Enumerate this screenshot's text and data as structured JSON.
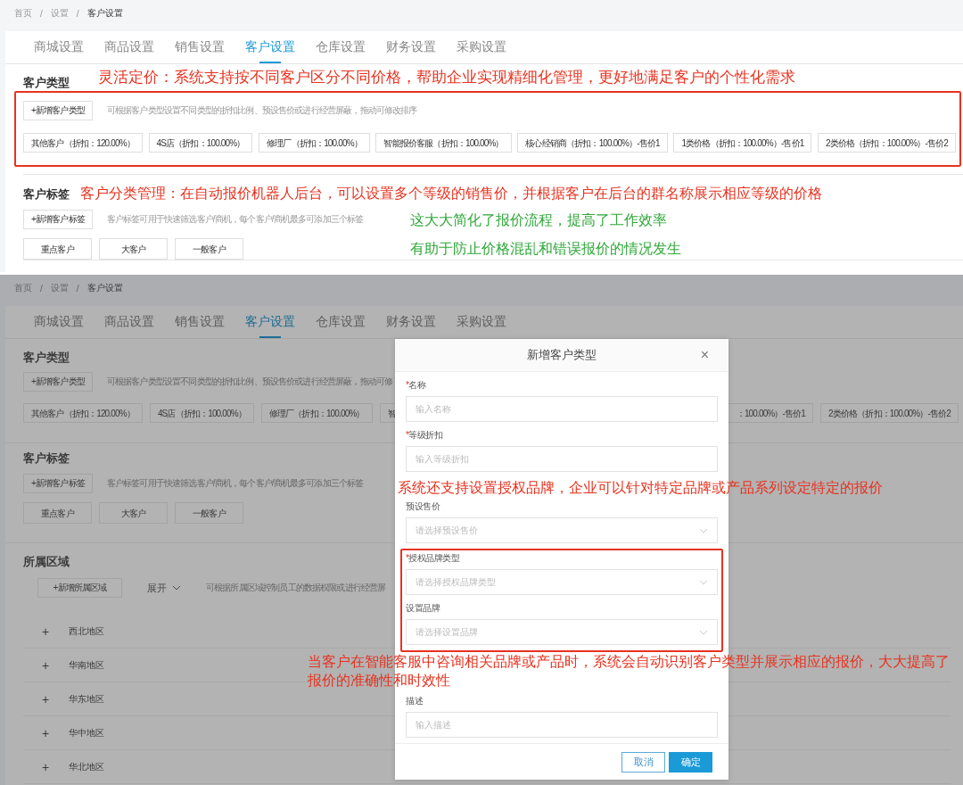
{
  "top_view": {
    "breadcrumb": [
      {
        "label": "首页",
        "separator": "/"
      },
      {
        "label": "设置",
        "separator": "/"
      },
      {
        "label": "客户设置"
      }
    ],
    "tabs": [
      {
        "label": "商城设置",
        "selected": false
      },
      {
        "label": "商品设置",
        "selected": false
      },
      {
        "label": "销售设置",
        "selected": false
      },
      {
        "label": "客户设置",
        "selected": true
      },
      {
        "label": "仓库设置",
        "selected": false
      },
      {
        "label": "财务设置",
        "selected": false
      },
      {
        "label": "采购设置",
        "selected": false
      }
    ],
    "customer_types": {
      "title": "客户类型",
      "annotation": "灵活定价：系统支持按不同客户区分不同价格，帮助企业实现精细化管理，更好地满足客户的个性化需求",
      "highlighted": true,
      "add_button": "+新增客户类型",
      "description": "可根据客户类型设置不同类型的折扣比例、预设售价或进行经营屏蔽，拖动可修改排序",
      "items": [
        "其他客户（折扣：120.00%）",
        "4S店（折扣：100.00%）",
        "修理厂（折扣：100.00%）",
        "智能报价客服（折扣：100.00%）",
        "核心经销商（折扣：100.00%）-售价1",
        "1类价格（折扣：100.00%）-售价1",
        "2类价格（折扣：100.00%）-售价2"
      ]
    },
    "customer_tags": {
      "title": "客户标签",
      "annotation": "客户分类管理：在自动报价机器人后台，可以设置多个等级的销售价，并根据客户在后台的群名称展示相应等级的价格",
      "add_button": "+新增客户标签",
      "description": "客户标签可用于快速筛选客户/商机，每个客户/商机最多可添加三个标签",
      "items": [
        "重点客户",
        "大客户",
        "一般客户"
      ]
    },
    "notes": [
      "这大大简化了报价流程，提高了工作效率",
      "有助于防止价格混乱和错误报价的情况发生"
    ]
  },
  "bottom_view": {
    "breadcrumb": [
      {
        "label": "首页",
        "separator": "/"
      },
      {
        "label": "设置",
        "separator": "/"
      },
      {
        "label": "客户设置"
      }
    ],
    "tabs": [
      {
        "label": "商城设置",
        "selected": false
      },
      {
        "label": "商品设置",
        "selected": false
      },
      {
        "label": "销售设置",
        "selected": false
      },
      {
        "label": "客户设置",
        "selected": true
      },
      {
        "label": "仓库设置",
        "selected": false
      },
      {
        "label": "财务设置",
        "selected": false
      },
      {
        "label": "采购设置",
        "selected": false
      }
    ],
    "customer_types": {
      "title": "客户类型",
      "add_button": "+新增客户类型",
      "description": "可根据客户类型设置不同类型的折扣比例、预设售价或进行经营屏蔽，拖动可修",
      "items": [
        "其他客户（折扣：120.00%）",
        "4S店（折扣：100.00%）",
        "修理厂（折扣：100.00%）",
        "智",
        "：100.00%）-售价1",
        "2类价格（折扣：100.00%）-售价2"
      ]
    },
    "customer_tags": {
      "title": "客户标签",
      "add_button": "+新增客户标签",
      "description": "客户标签可用于快速筛选客户/商机，每个客户/商机最多可添加三个标签",
      "items": [
        "重点客户",
        "大客户",
        "一般客户"
      ]
    },
    "regions": {
      "title": "所属区域",
      "add_button": "+新增所属区域",
      "expand_toggle": "展开",
      "description": "可根据所属区域控制员工的数据权限或进行经营屏",
      "rows": [
        {
          "toggle": "+",
          "label": "西北地区"
        },
        {
          "toggle": "+",
          "label": "华南地区"
        },
        {
          "toggle": "+",
          "label": "华东地区"
        },
        {
          "toggle": "+",
          "label": "华中地区"
        },
        {
          "toggle": "+",
          "label": "华北地区"
        }
      ]
    },
    "dialog": {
      "title": "新增客户类型",
      "close": "×",
      "fields": [
        {
          "mark": "*",
          "label": "名称",
          "kind": "input",
          "placeholder": "输入名称",
          "highlighted": false
        },
        {
          "mark": "*",
          "label": "等级折扣",
          "kind": "input",
          "placeholder": "输入等级折扣",
          "highlighted": false
        },
        {
          "label": "预设售价",
          "kind": "select",
          "placeholder": "请选择预设售价",
          "highlighted": false
        },
        {
          "mark": "*",
          "label": "授权品牌类型",
          "kind": "select",
          "placeholder": "请选择授权品牌类型",
          "highlighted": true
        },
        {
          "label": "设置品牌",
          "kind": "select",
          "placeholder": "请选择设置品牌",
          "highlighted": true
        },
        {
          "label": "描述",
          "kind": "input",
          "placeholder": "输入描述",
          "highlighted": false
        }
      ],
      "buttons": [
        {
          "label": "取消",
          "kind": "secondary"
        },
        {
          "label": "确定",
          "kind": "primary"
        }
      ]
    },
    "notes": [
      "系统还支持设置授权品牌，企业可以针对特定品牌或产品系列设定特定的报价",
      "当客户在智能客服中咨询相关品牌或产品时，系统会自动识别客户类型并展示相应的报价，大大提高了报价的准确性和时效性"
    ]
  }
}
